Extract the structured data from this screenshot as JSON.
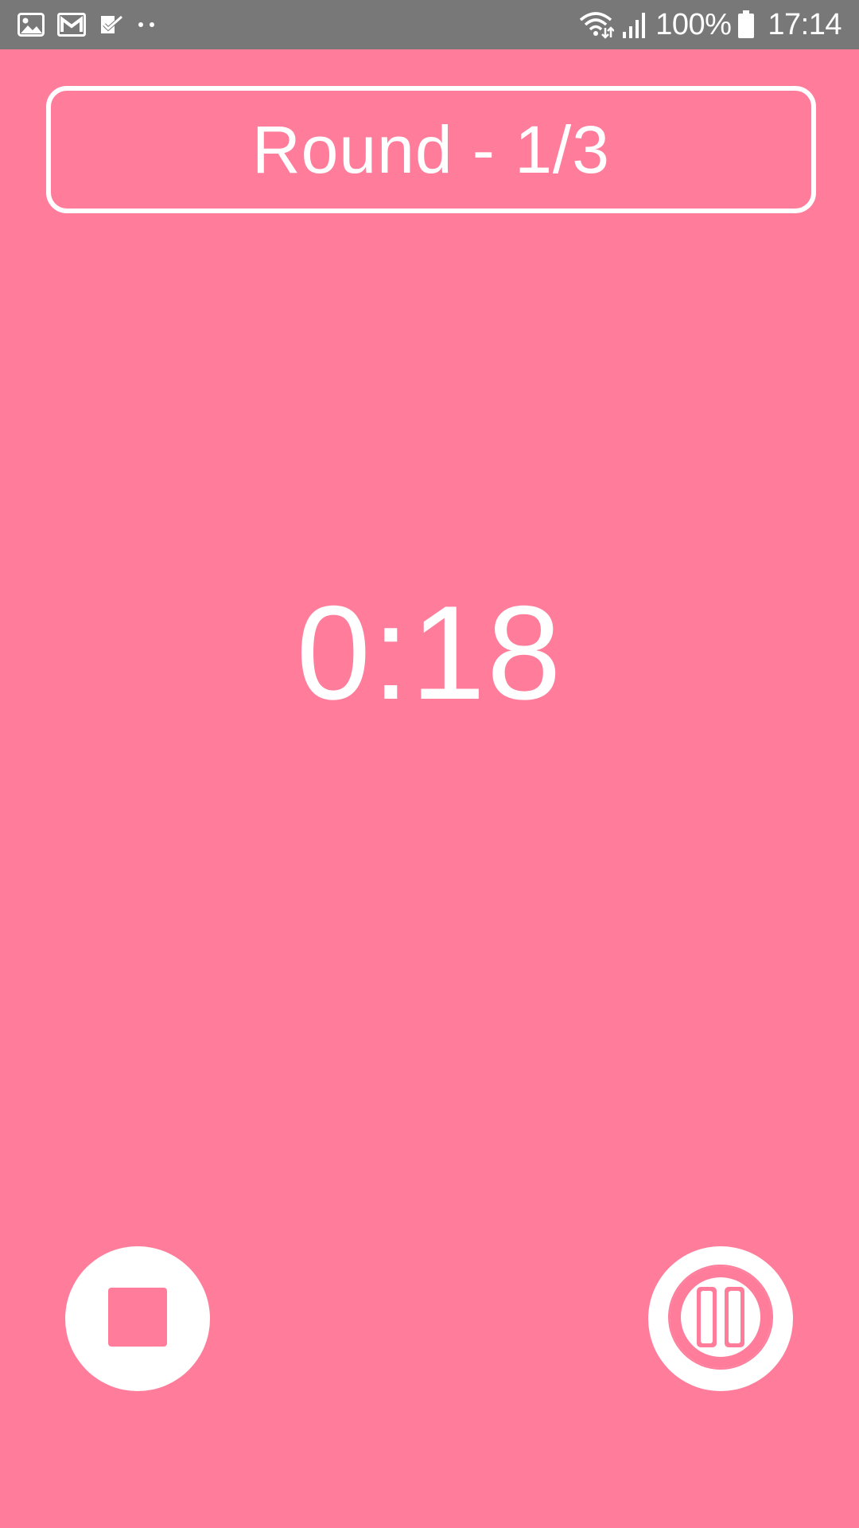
{
  "status_bar": {
    "left_icons": [
      "gallery-icon",
      "gmail-icon",
      "tasks-icon",
      "more-notifications-icon"
    ],
    "right_icons": [
      "wifi-icon",
      "signal-icon",
      "battery-icon"
    ],
    "battery": "100%",
    "time": "17:14"
  },
  "round": {
    "label": "Round - 1/3"
  },
  "timer": {
    "value": "0:18"
  },
  "controls": {
    "stop_icon": "stop-icon",
    "pause_icon": "pause-icon"
  },
  "colors": {
    "background": "#ff7d9b",
    "status_bar": "#787878",
    "foreground": "#ffffff"
  }
}
